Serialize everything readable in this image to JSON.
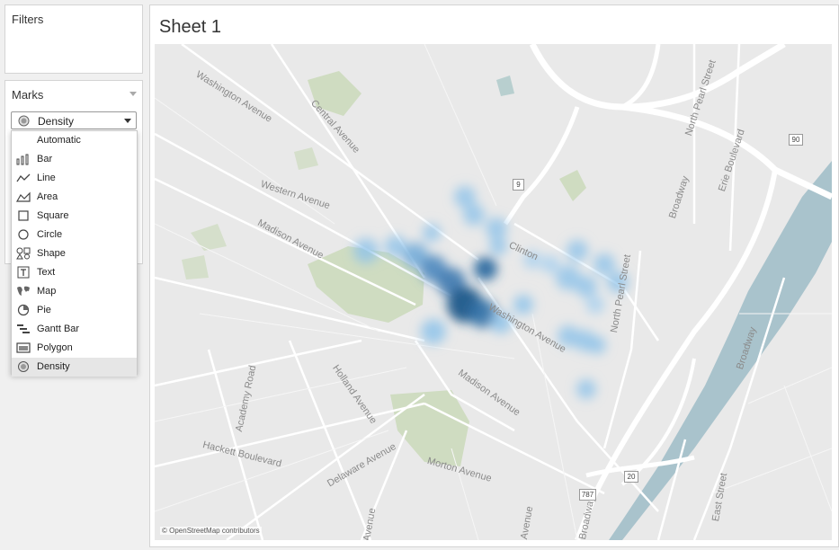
{
  "filters": {
    "title": "Filters"
  },
  "marks": {
    "title": "Marks",
    "selected": {
      "label": "Density",
      "icon": "density-icon"
    },
    "options": [
      {
        "label": "Automatic",
        "icon": ""
      },
      {
        "label": "Bar",
        "icon": "bar-icon"
      },
      {
        "label": "Line",
        "icon": "line-icon"
      },
      {
        "label": "Area",
        "icon": "area-icon"
      },
      {
        "label": "Square",
        "icon": "square-icon"
      },
      {
        "label": "Circle",
        "icon": "circle-icon"
      },
      {
        "label": "Shape",
        "icon": "shape-icon"
      },
      {
        "label": "Text",
        "icon": "text-icon"
      },
      {
        "label": "Map",
        "icon": "map-icon"
      },
      {
        "label": "Pie",
        "icon": "pie-icon"
      },
      {
        "label": "Gantt Bar",
        "icon": "gantt-bar-icon"
      },
      {
        "label": "Polygon",
        "icon": "polygon-icon"
      },
      {
        "label": "Density",
        "icon": "density-icon"
      }
    ]
  },
  "sheet": {
    "title": "Sheet 1"
  },
  "map": {
    "attribution": "© OpenStreetMap contributors",
    "density_color": "#1f5a8a",
    "streets": [
      "Washington Avenue",
      "Central Avenue",
      "Western Avenue",
      "Madison Avenue",
      "Holland Avenue",
      "Academy Road",
      "Hackett Boulevard",
      "Delaware Avenue",
      "Morton Avenue",
      "Madison Avenue",
      "Washington Avenue",
      "Clinton",
      "North Pearl Street",
      "Erie Boulevard",
      "Broadway",
      "North Pearl Street",
      "Broadway",
      "East Street",
      "Broadway",
      "Avenue",
      "Avenue"
    ],
    "route_shields": [
      "9",
      "90",
      "20",
      "787"
    ]
  }
}
